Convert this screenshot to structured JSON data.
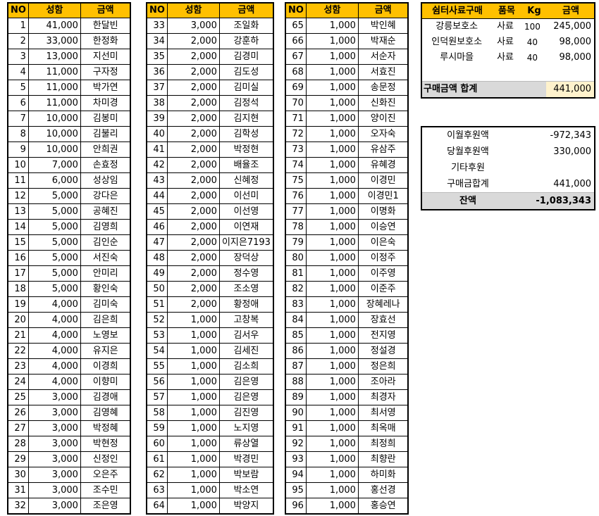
{
  "headers": {
    "no": "NO",
    "name": "성함",
    "amount": "금액"
  },
  "donors": [
    {
      "no": "1",
      "amount": "41,000",
      "name": "한달빈"
    },
    {
      "no": "2",
      "amount": "33,000",
      "name": "한정화"
    },
    {
      "no": "3",
      "amount": "13,000",
      "name": "지선미"
    },
    {
      "no": "4",
      "amount": "11,000",
      "name": "구자정"
    },
    {
      "no": "5",
      "amount": "11,000",
      "name": "박가연"
    },
    {
      "no": "6",
      "amount": "11,000",
      "name": "차미경"
    },
    {
      "no": "7",
      "amount": "10,000",
      "name": "김봉미"
    },
    {
      "no": "8",
      "amount": "10,000",
      "name": "김불리"
    },
    {
      "no": "9",
      "amount": "10,000",
      "name": "안희권"
    },
    {
      "no": "10",
      "amount": "7,000",
      "name": "손효정"
    },
    {
      "no": "11",
      "amount": "6,000",
      "name": "성상임"
    },
    {
      "no": "12",
      "amount": "5,000",
      "name": "강다은"
    },
    {
      "no": "13",
      "amount": "5,000",
      "name": "공혜진"
    },
    {
      "no": "14",
      "amount": "5,000",
      "name": "김영희"
    },
    {
      "no": "15",
      "amount": "5,000",
      "name": "김인순"
    },
    {
      "no": "16",
      "amount": "5,000",
      "name": "서진숙"
    },
    {
      "no": "17",
      "amount": "5,000",
      "name": "안미리"
    },
    {
      "no": "18",
      "amount": "5,000",
      "name": "황인숙"
    },
    {
      "no": "19",
      "amount": "4,000",
      "name": "김미숙"
    },
    {
      "no": "20",
      "amount": "4,000",
      "name": "김은희"
    },
    {
      "no": "21",
      "amount": "4,000",
      "name": "노영보"
    },
    {
      "no": "22",
      "amount": "4,000",
      "name": "유지은"
    },
    {
      "no": "23",
      "amount": "4,000",
      "name": "이경희"
    },
    {
      "no": "24",
      "amount": "4,000",
      "name": "이향미"
    },
    {
      "no": "25",
      "amount": "3,000",
      "name": "김경애"
    },
    {
      "no": "26",
      "amount": "3,000",
      "name": "김영혜"
    },
    {
      "no": "27",
      "amount": "3,000",
      "name": "박정혜"
    },
    {
      "no": "28",
      "amount": "3,000",
      "name": "박현정"
    },
    {
      "no": "29",
      "amount": "3,000",
      "name": "신정인"
    },
    {
      "no": "30",
      "amount": "3,000",
      "name": "오은주"
    },
    {
      "no": "31",
      "amount": "3,000",
      "name": "조수민"
    },
    {
      "no": "32",
      "amount": "3,000",
      "name": "조은영"
    },
    {
      "no": "33",
      "amount": "3,000",
      "name": "조일화"
    },
    {
      "no": "34",
      "amount": "2,000",
      "name": "강훈하"
    },
    {
      "no": "35",
      "amount": "2,000",
      "name": "김경미"
    },
    {
      "no": "36",
      "amount": "2,000",
      "name": "김도성"
    },
    {
      "no": "37",
      "amount": "2,000",
      "name": "김미실"
    },
    {
      "no": "38",
      "amount": "2,000",
      "name": "김정석"
    },
    {
      "no": "39",
      "amount": "2,000",
      "name": "김지현"
    },
    {
      "no": "40",
      "amount": "2,000",
      "name": "김학성"
    },
    {
      "no": "41",
      "amount": "2,000",
      "name": "박정현"
    },
    {
      "no": "42",
      "amount": "2,000",
      "name": "배율조"
    },
    {
      "no": "43",
      "amount": "2,000",
      "name": "신혜정"
    },
    {
      "no": "44",
      "amount": "2,000",
      "name": "이선미"
    },
    {
      "no": "45",
      "amount": "2,000",
      "name": "이선영"
    },
    {
      "no": "46",
      "amount": "2,000",
      "name": "이연재"
    },
    {
      "no": "47",
      "amount": "2,000",
      "name": "이지은7193"
    },
    {
      "no": "48",
      "amount": "2,000",
      "name": "장덕상"
    },
    {
      "no": "49",
      "amount": "2,000",
      "name": "정수영"
    },
    {
      "no": "50",
      "amount": "2,000",
      "name": "조소영"
    },
    {
      "no": "51",
      "amount": "2,000",
      "name": "황정애"
    },
    {
      "no": "52",
      "amount": "1,000",
      "name": "고창복"
    },
    {
      "no": "53",
      "amount": "1,000",
      "name": "김서우"
    },
    {
      "no": "54",
      "amount": "1,000",
      "name": "김세진"
    },
    {
      "no": "55",
      "amount": "1,000",
      "name": "김소희"
    },
    {
      "no": "56",
      "amount": "1,000",
      "name": "김은영"
    },
    {
      "no": "57",
      "amount": "1,000",
      "name": "김은영"
    },
    {
      "no": "58",
      "amount": "1,000",
      "name": "김진영"
    },
    {
      "no": "59",
      "amount": "1,000",
      "name": "노지영"
    },
    {
      "no": "60",
      "amount": "1,000",
      "name": "류상열"
    },
    {
      "no": "61",
      "amount": "1,000",
      "name": "박경민"
    },
    {
      "no": "62",
      "amount": "1,000",
      "name": "박보람"
    },
    {
      "no": "63",
      "amount": "1,000",
      "name": "박소연"
    },
    {
      "no": "64",
      "amount": "1,000",
      "name": "박양지"
    },
    {
      "no": "65",
      "amount": "1,000",
      "name": "박인혜"
    },
    {
      "no": "66",
      "amount": "1,000",
      "name": "박재순"
    },
    {
      "no": "67",
      "amount": "1,000",
      "name": "서순자"
    },
    {
      "no": "68",
      "amount": "1,000",
      "name": "서효진"
    },
    {
      "no": "69",
      "amount": "1,000",
      "name": "송문정"
    },
    {
      "no": "70",
      "amount": "1,000",
      "name": "신화진"
    },
    {
      "no": "71",
      "amount": "1,000",
      "name": "양이진"
    },
    {
      "no": "72",
      "amount": "1,000",
      "name": "오자숙"
    },
    {
      "no": "73",
      "amount": "1,000",
      "name": "유삼주"
    },
    {
      "no": "74",
      "amount": "1,000",
      "name": "유혜경"
    },
    {
      "no": "75",
      "amount": "1,000",
      "name": "이경민"
    },
    {
      "no": "76",
      "amount": "1,000",
      "name": "이경민1"
    },
    {
      "no": "77",
      "amount": "1,000",
      "name": "이명화"
    },
    {
      "no": "78",
      "amount": "1,000",
      "name": "이승연"
    },
    {
      "no": "79",
      "amount": "1,000",
      "name": "이은숙"
    },
    {
      "no": "80",
      "amount": "1,000",
      "name": "이정주"
    },
    {
      "no": "81",
      "amount": "1,000",
      "name": "이주영"
    },
    {
      "no": "82",
      "amount": "1,000",
      "name": "이준주"
    },
    {
      "no": "83",
      "amount": "1,000",
      "name": "장혜레나"
    },
    {
      "no": "84",
      "amount": "1,000",
      "name": "장효선"
    },
    {
      "no": "85",
      "amount": "1,000",
      "name": "전지영"
    },
    {
      "no": "86",
      "amount": "1,000",
      "name": "정설경"
    },
    {
      "no": "87",
      "amount": "1,000",
      "name": "정은희"
    },
    {
      "no": "88",
      "amount": "1,000",
      "name": "조아라"
    },
    {
      "no": "89",
      "amount": "1,000",
      "name": "최경자"
    },
    {
      "no": "90",
      "amount": "1,000",
      "name": "최서영"
    },
    {
      "no": "91",
      "amount": "1,000",
      "name": "최옥매"
    },
    {
      "no": "92",
      "amount": "1,000",
      "name": "최정희"
    },
    {
      "no": "93",
      "amount": "1,000",
      "name": "최향란"
    },
    {
      "no": "94",
      "amount": "1,000",
      "name": "하미화"
    },
    {
      "no": "95",
      "amount": "1,000",
      "name": "홍선경"
    },
    {
      "no": "96",
      "amount": "1,000",
      "name": "홍승연"
    }
  ],
  "purchase": {
    "headers": [
      "쉼터사료구매",
      "품목",
      "Kg",
      "금액"
    ],
    "rows": [
      {
        "shelter": "강릉보호소",
        "item": "사료",
        "kg": "100",
        "amount": "245,000"
      },
      {
        "shelter": "인덕원보호소",
        "item": "사료",
        "kg": "40",
        "amount": "98,000"
      },
      {
        "shelter": "루시마을",
        "item": "사료",
        "kg": "40",
        "amount": "98,000"
      }
    ],
    "total_label": "구매금액 합계",
    "total_value": "441,000"
  },
  "balance": {
    "rows": [
      {
        "label": "이월후원액",
        "value": "-972,343"
      },
      {
        "label": "당월후원액",
        "value": "330,000"
      },
      {
        "label": "기타후원",
        "value": ""
      },
      {
        "label": "구매금합계",
        "value": "441,000"
      }
    ],
    "final_label": "잔액",
    "final_value": "-1,083,343"
  }
}
